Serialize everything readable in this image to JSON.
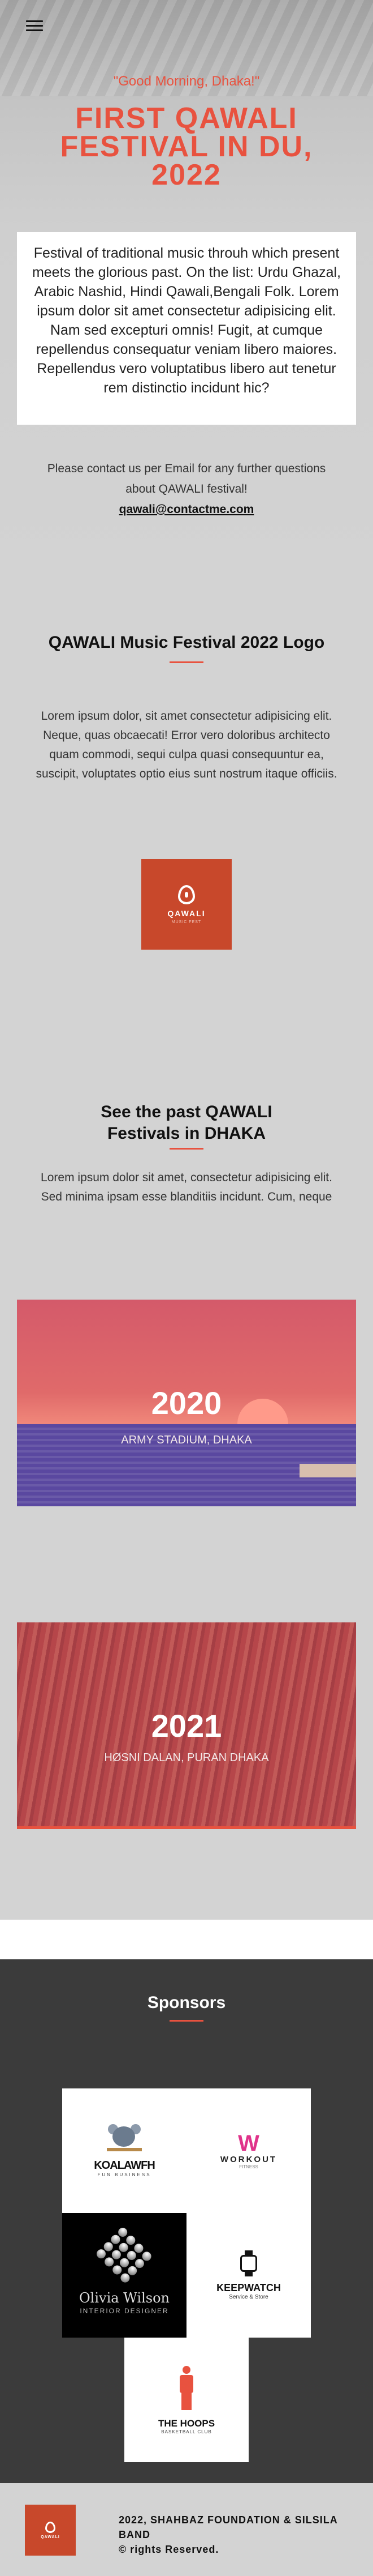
{
  "hero": {
    "greeting": "\"Good Morning, Dhaka!\"",
    "title": "First QAWALI festival in DU, 2022",
    "intro": "Festival of traditional music throuh which present meets the glorious past. On the list: Urdu Ghazal, Arabic Nashid, Hindi Qawali,Bengali Folk. Lorem ipsum dolor sit amet consectetur adipisicing elit. Nam sed excepturi omnis! Fugit, at cumque repellendus consequatur veniam libero maiores. Repellendus vero voluptatibus libero aut tenetur rem distinctio incidunt hic?",
    "contact_text": "Please contact us per Email for any further questions about QAWALI festival!",
    "contact_email": "qawali@contactme.com"
  },
  "logo_section": {
    "title": "QAWALI Music Festival 2022 Logo",
    "text": "Lorem ipsum dolor, sit amet consectetur adipisicing elit. Neque, quas obcaecati! Error vero doloribus architecto quam commodi, sequi culpa quasi consequuntur ea, suscipit, voluptates optio eius sunt nostrum itaque officiis.",
    "logo_word": "QAWALI",
    "logo_sub": "MUSIC FEST"
  },
  "past_section": {
    "title_line1": "See the past QAWALI",
    "title_line2": "Festivals in DHAKA",
    "text": "Lorem ipsum dolor sit amet, consectetur adipisicing elit. Sed minima ipsam esse blanditiis incidunt. Cum, neque",
    "festivals": [
      {
        "year": "2020",
        "place": "ARMY STADIUM, DHAKA"
      },
      {
        "year": "2021",
        "place": "HØSNI DALAN, PURAN DHAKA"
      }
    ]
  },
  "sponsors": {
    "title": "Sponsors",
    "items": [
      {
        "name": "KOALAWFH",
        "sub": "FUN BUSINESS"
      },
      {
        "name": "WORKOUT",
        "sub": "FITNESS"
      },
      {
        "name": "Olivia Wilson",
        "sub": "INTERIOR DESIGNER"
      },
      {
        "name": "KEEPWATCH",
        "sub": "Service & Store"
      },
      {
        "name": "THE HOOPS",
        "sub": "BASKETBALL CLUB"
      }
    ]
  },
  "footer": {
    "logo_word": "QAWALI",
    "line1": "2022, SHAHBAZ FOUNDATION & SILSILA BAND",
    "line2": "© rights Reserved."
  },
  "colors": {
    "accent": "#e8523f",
    "logo_bg": "#c8482b",
    "section_bg": "#d3d3d3",
    "sponsors_bg": "#3b3b3b"
  }
}
